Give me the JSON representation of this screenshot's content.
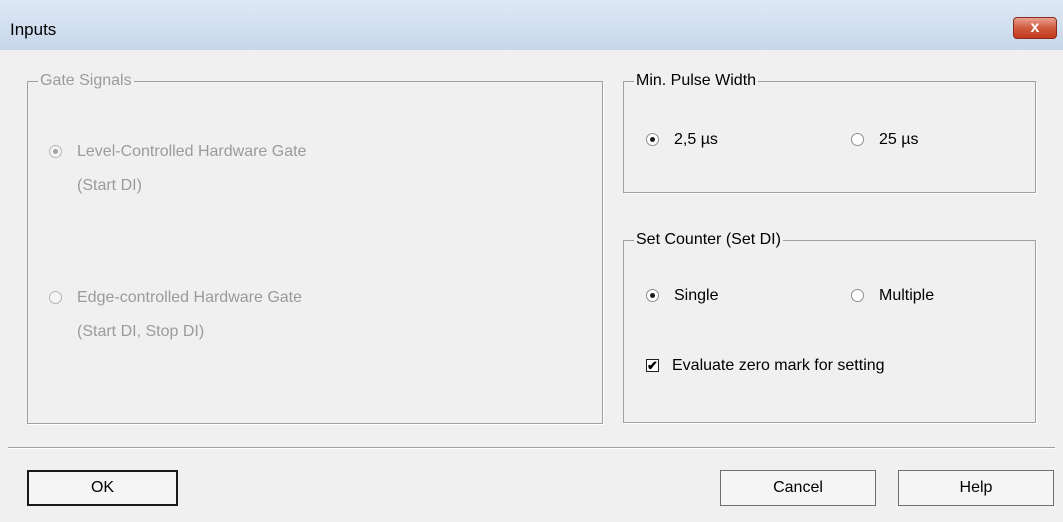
{
  "window": {
    "title": "Inputs",
    "close_label": "x"
  },
  "gate_signals": {
    "legend": "Gate Signals",
    "level_label": "Level-Controlled Hardware Gate",
    "level_sub": "(Start DI)",
    "edge_label": "Edge-controlled Hardware Gate",
    "edge_sub": "(Start DI, Stop DI)",
    "selected": "level"
  },
  "pulse_width": {
    "legend": "Min. Pulse Width",
    "option1": "2,5 µs",
    "option2": "25 µs",
    "selected": "option1"
  },
  "set_counter": {
    "legend": "Set Counter (Set DI)",
    "option1": "Single",
    "option2": "Multiple",
    "selected": "option1",
    "checkbox_label": "Evaluate zero mark for setting",
    "checkbox_checked": true
  },
  "buttons": {
    "ok": "OK",
    "cancel": "Cancel",
    "help": "Help"
  }
}
